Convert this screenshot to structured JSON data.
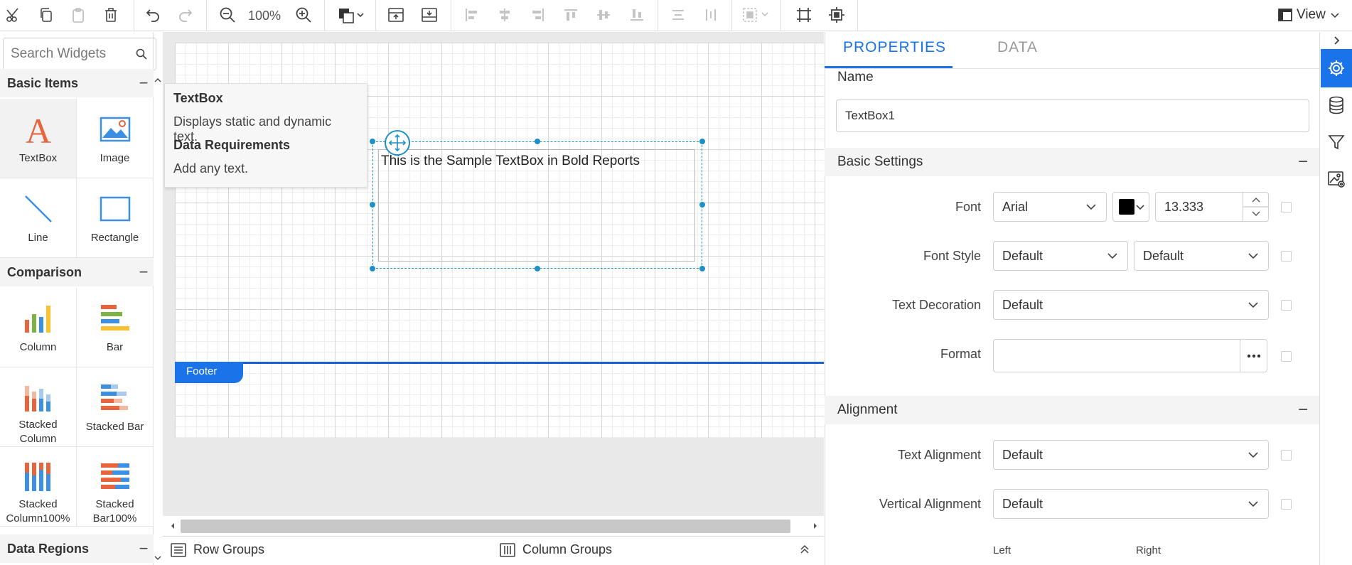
{
  "toolbar": {
    "zoom_value": "100%",
    "view_label": "View",
    "icons": [
      "cut-icon",
      "copy-icon",
      "paste-icon",
      "delete-icon",
      "undo-icon",
      "redo-icon",
      "zoom-out-icon",
      "zoom-in-icon",
      "fill-color-icon",
      "header-icon",
      "footer-icon",
      "align-left-icon",
      "align-center-icon",
      "align-right-icon",
      "align-top-icon",
      "align-middle-icon",
      "align-bottom-icon",
      "distribute-horizontal-icon",
      "distribute-vertical-icon",
      "group-icon",
      "fit-icon",
      "center-icon",
      "view-icon"
    ]
  },
  "left_panel": {
    "search_placeholder": "Search Widgets",
    "categories": [
      {
        "name": "Basic Items",
        "collapse": "−"
      },
      {
        "name": "Comparison",
        "collapse": "−"
      },
      {
        "name": "Data Regions",
        "collapse": "−"
      }
    ],
    "basic_items": [
      {
        "label": "TextBox",
        "icon": "textbox-icon"
      },
      {
        "label": "Image",
        "icon": "image-icon"
      },
      {
        "label": "Line",
        "icon": "line-icon"
      },
      {
        "label": "Rectangle",
        "icon": "rectangle-icon"
      }
    ],
    "comparison_items": [
      {
        "label": "Column",
        "icon": "column-chart-icon"
      },
      {
        "label": "Bar",
        "icon": "bar-chart-icon"
      },
      {
        "label": "Stacked Column",
        "icon": "stacked-column-icon"
      },
      {
        "label": "Stacked Bar",
        "icon": "stacked-bar-icon"
      },
      {
        "label": "Stacked Column100%",
        "icon": "stacked-column100-icon"
      },
      {
        "label": "Stacked Bar100%",
        "icon": "stacked-bar100-icon"
      }
    ]
  },
  "tooltip": {
    "title": "TextBox",
    "description": "Displays static and dynamic text.",
    "requirements_title": "Data Requirements",
    "requirements_text": "Add any text."
  },
  "canvas": {
    "textbox_text": "This is the Sample TextBox in Bold Reports",
    "footer_label": "Footer"
  },
  "bottom_bar": {
    "row_groups": "Row Groups",
    "column_groups": "Column Groups"
  },
  "properties": {
    "tabs": [
      "PROPERTIES",
      "DATA"
    ],
    "name_label": "Name",
    "name_value": "TextBox1",
    "basic_settings": "Basic Settings",
    "font_label": "Font",
    "font_value": "Arial",
    "font_color": "#000000",
    "font_size": "13.333",
    "font_style_label": "Font Style",
    "font_style_value": "Default",
    "font_weight_value": "Default",
    "text_decoration_label": "Text Decoration",
    "text_decoration_value": "Default",
    "format_label": "Format",
    "format_value": "",
    "alignment": "Alignment",
    "text_alignment_label": "Text Alignment",
    "text_alignment_value": "Default",
    "vertical_alignment_label": "Vertical Alignment",
    "vertical_alignment_value": "Default",
    "padding_left": "Left",
    "padding_right": "Right",
    "collapse": "−"
  },
  "colors": {
    "accent": "#1a73e8",
    "selection": "#1e90c8",
    "footer": "#1a5fd6"
  }
}
